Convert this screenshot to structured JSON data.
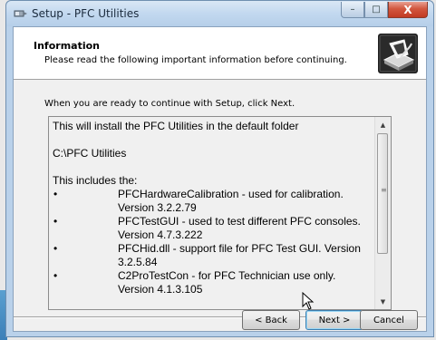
{
  "window": {
    "title": "Setup - PFC Utilities",
    "controls": {
      "minimize": "–",
      "maximize": "□",
      "close": "X"
    }
  },
  "header": {
    "title": "Information",
    "subtitle": "Please read the following important information before continuing."
  },
  "instruction": "When you are ready to continue with Setup, click Next.",
  "memo": {
    "line1": "This will install the PFC Utilities in the default folder",
    "line2": "C:\\PFC Utilities",
    "line3": "This includes the:",
    "bullet_char": "•",
    "items": [
      "PFCHardwareCalibration - used for calibration. Version 3.2.2.79",
      "PFCTestGUI - used to test different PFC consoles. Version 4.7.3.222",
      "PFCHid.dll - support file for PFC Test GUI. Version 3.2.5.84",
      "C2ProTestCon - for PFC Technician use only. Version 4.1.3.105"
    ]
  },
  "buttons": {
    "back": "< Back",
    "next": "Next >",
    "cancel": "Cancel"
  },
  "icons": {
    "app": "setup-app-icon",
    "header": "computer-install-icon",
    "cursor": "mouse-pointer-icon"
  },
  "colors": {
    "title_bar": "#c2d8ef",
    "close_button": "#c9432b",
    "client_bg": "#f0f0f0"
  }
}
